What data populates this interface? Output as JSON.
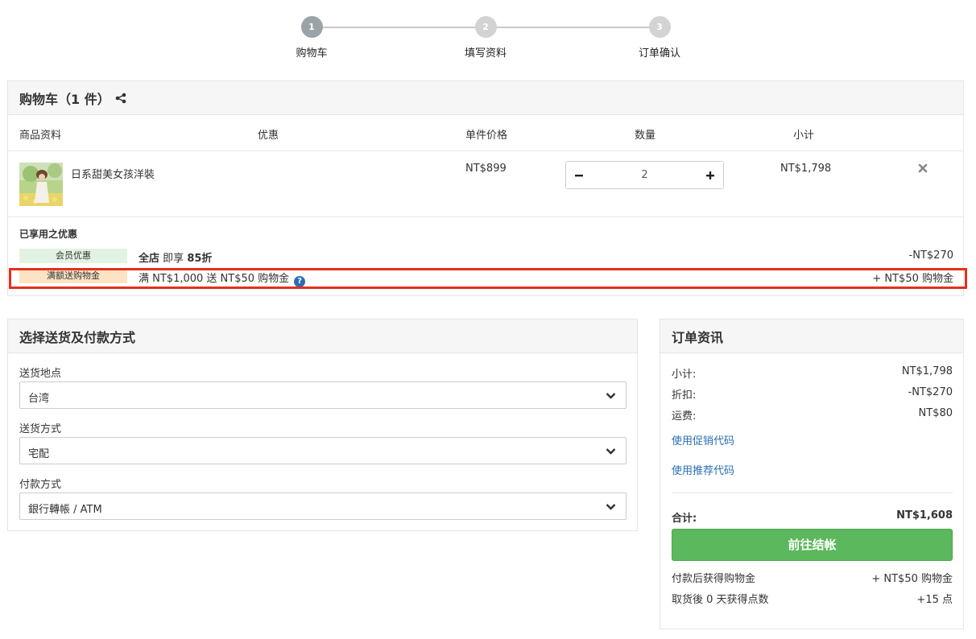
{
  "stepper": {
    "steps": [
      {
        "number": "1",
        "label": "购物车"
      },
      {
        "number": "2",
        "label": "填写资料"
      },
      {
        "number": "3",
        "label": "订单确认"
      }
    ]
  },
  "cart": {
    "title": "购物车（1 件）",
    "columns": {
      "product": "商品资料",
      "discount": "优惠",
      "unit_price": "单件价格",
      "quantity": "数量",
      "subtotal": "小计"
    },
    "items": [
      {
        "name": "日系甜美女孩洋裝",
        "unit_price": "NT$899",
        "quantity": "2",
        "subtotal": "NT$1,798"
      }
    ],
    "applied_promotions_title": "已享用之优惠",
    "promotions": [
      {
        "badge": "会员优惠",
        "desc_bold": "全店",
        "desc_mid": "即享",
        "desc_bold2": "85折",
        "amount": "-NT$270"
      },
      {
        "badge": "满额送购物金",
        "desc": "满 NT$1,000 送 NT$50 购物金",
        "amount": "+ NT$50 购物金"
      }
    ]
  },
  "shipping": {
    "title": "选择送货及付款方式",
    "fields": [
      {
        "label": "送货地点",
        "value": "台湾"
      },
      {
        "label": "送货方式",
        "value": "宅配"
      },
      {
        "label": "付款方式",
        "value": "銀行轉帳 / ATM"
      }
    ]
  },
  "order": {
    "title": "订单资讯",
    "subtotal_label": "小计:",
    "subtotal_value": "NT$1,798",
    "discount_label": "折扣:",
    "discount_value": "-NT$270",
    "shipping_label": "运费:",
    "shipping_value": "NT$80",
    "promo_code_link": "使用促销代码",
    "referral_code_link": "使用推荐代码",
    "total_label": "合计:",
    "total_value": "NT$1,608",
    "checkout_label": "前往结帐",
    "credit_label": "付款后获得购物金",
    "credit_value": "+ NT$50 购物金",
    "points_label": "取货後 0 天获得点数",
    "points_value": "+15 点"
  },
  "colors": {
    "step_active": "#9aa3aa",
    "step_inactive": "#d3d3d3",
    "checkout_green": "#5cb85c",
    "link_blue": "#2a6db5",
    "highlight_red": "#e3301d",
    "member_badge": "#e3f3e3",
    "credit_badge": "#fde3c3"
  },
  "icons": [
    "share-icon",
    "minus-icon",
    "plus-icon",
    "remove-icon",
    "help-icon",
    "chevron-down-icon"
  ]
}
